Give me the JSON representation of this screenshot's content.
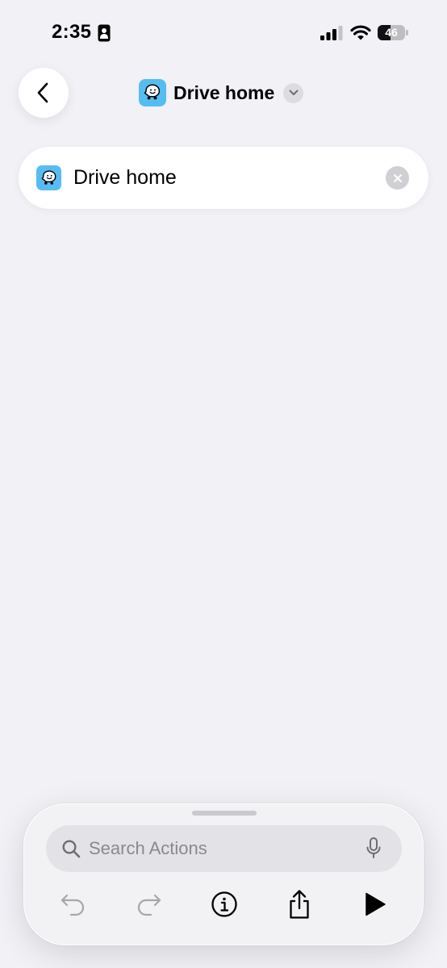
{
  "status_bar": {
    "time": "2:35",
    "battery_level": "46",
    "battery_fraction": 0.46
  },
  "nav": {
    "title": "Drive home",
    "back_icon": "chevron-left-icon",
    "dropdown_icon": "chevron-down-icon"
  },
  "shortcut": {
    "name": "Drive home",
    "icon": "waze-app-icon",
    "icon_color": "#55bdf2"
  },
  "bottom_sheet": {
    "search_placeholder": "Search Actions",
    "toolbar": [
      "undo-icon",
      "redo-icon",
      "info-icon",
      "share-icon",
      "play-icon"
    ]
  }
}
